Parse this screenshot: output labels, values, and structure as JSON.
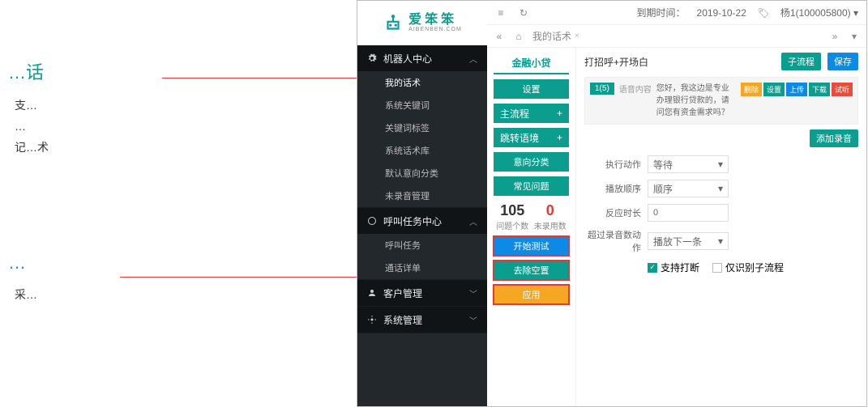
{
  "annotations": {
    "sec1_title": "…话",
    "sec1_items": [
      "支…",
      "…",
      "记…术"
    ],
    "sec2_title": "…",
    "sec2_items": [
      "采…"
    ]
  },
  "logo": {
    "cn": "爱笨笨",
    "en": "AIBENBEN.COM"
  },
  "sidebar": {
    "groups": [
      {
        "name": "机器人中心",
        "open": true,
        "items": [
          "我的话术",
          "系统关键词",
          "关键词标签",
          "系统话术库",
          "默认意向分类",
          "未录音管理"
        ]
      },
      {
        "name": "呼叫任务中心",
        "open": true,
        "items": [
          "呼叫任务",
          "通话详单"
        ]
      },
      {
        "name": "客户管理",
        "open": false,
        "items": []
      },
      {
        "name": "系统管理",
        "open": false,
        "items": []
      }
    ]
  },
  "topbar": {
    "expire_label": "到期时间：",
    "expire_date": "2019-10-22",
    "user": "杨1(10000580­0)"
  },
  "tabs": {
    "home": "",
    "current": "我的话术"
  },
  "workspace": {
    "title": "金融小贷",
    "main_title": "打招呼+开场白",
    "subflow": "子流程",
    "save": "保存",
    "settings": "设置",
    "mainflow": "主流程",
    "jump": "跳转语境",
    "intent": "意向分类",
    "faq": "常见问题",
    "count_q": 105,
    "count_q_lbl": "问题个数",
    "count_u": 0,
    "count_u_lbl": "未录用数",
    "start_test": "开始测试",
    "trim": "去除空置",
    "apply": "应用"
  },
  "node": {
    "badge": "1(5)",
    "label": "语音内容",
    "text": "您好，我这边是专业办理银行贷款的，请问您有资金需求吗？",
    "acts": {
      "del": "删除",
      "set": "设置",
      "up": "上传",
      "dl": "下载",
      "try": "试听"
    }
  },
  "add_rec": "添加录音",
  "form": {
    "exec": "执行动作",
    "exec_v": "等待",
    "order": "播放顺序",
    "order_v": "顺序",
    "delay": "反应时长",
    "delay_v": "0",
    "over": "超过录音数动作",
    "over_v": "播放下一条",
    "support": "支持打断",
    "only": "仅识别子流程"
  }
}
